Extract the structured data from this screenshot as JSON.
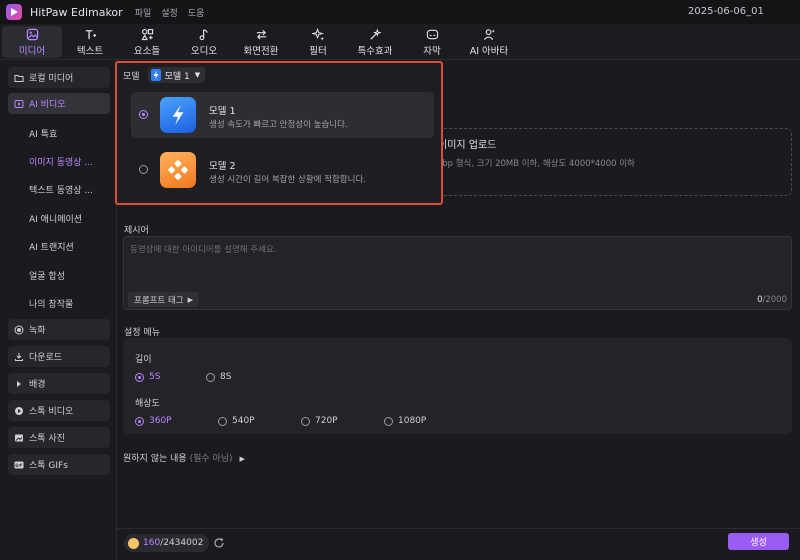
{
  "app": {
    "title": "HitPaw Edimakor",
    "menu": [
      "파일",
      "설정",
      "도움"
    ],
    "project_name": "2025-06-06_01"
  },
  "toolbar": {
    "items": [
      {
        "label": "미디어",
        "icon": "media-icon",
        "active": true
      },
      {
        "label": "텍스트",
        "icon": "text-icon"
      },
      {
        "label": "요소들",
        "icon": "elements-icon"
      },
      {
        "label": "오디오",
        "icon": "audio-icon"
      },
      {
        "label": "화면전환",
        "icon": "transition-icon"
      },
      {
        "label": "필터",
        "icon": "filter-icon"
      },
      {
        "label": "특수효과",
        "icon": "effects-icon"
      },
      {
        "label": "자막",
        "icon": "subtitle-icon"
      },
      {
        "label": "AI 아바타",
        "icon": "ai-avatar-icon"
      }
    ]
  },
  "sidebar": {
    "local_media": "로컬 미디어",
    "ai_video": "AI 비디오",
    "sub_items": [
      "AI 특효",
      "이미지 동영상 ...",
      "텍스트 동영상 ...",
      "AI 애니메이션",
      "AI 트랜지션",
      "얼굴 합성",
      "나의 창작물"
    ],
    "record": "녹화",
    "download": "다운로드",
    "background": "배경",
    "stock_video": "스톡 비디오",
    "stock_photo": "스톡 사진",
    "stock_gifs": "스톡 GIFs"
  },
  "upload": {
    "title": "이미지 업로드",
    "desc": "ebp 형식, 크기 20MB 이하, 해상도 4000*4000 이하"
  },
  "prompt": {
    "label": "제시어",
    "placeholder": "동영상에 대한 아이디어를 설명해 주세요.",
    "tag_button": "프롬프트 태그",
    "count_current": "0",
    "count_max": "/2000"
  },
  "settings": {
    "label": "설정 메뉴",
    "length_label": "길이",
    "length_options": [
      "5S",
      "8S"
    ],
    "length_selected": "5S",
    "resolution_label": "해상도",
    "resolution_options": [
      "360P",
      "540P",
      "720P",
      "1080P"
    ],
    "resolution_selected": "360P"
  },
  "negative": {
    "label": "원하지 않는 내용",
    "optional": "(필수 아님)"
  },
  "bottom": {
    "credits_current": "160",
    "credits_total": "/2434002",
    "generate": "생성"
  },
  "model_popup": {
    "label": "모델",
    "selected": "모델 1",
    "models": [
      {
        "name": "모델 1",
        "desc": "생성 속도가 빠르고 안정성이 높습니다.",
        "icon": "lightning-icon",
        "color": "#2f7df0"
      },
      {
        "name": "모델 2",
        "desc": "생성 시간이 길어 복잡한 상황에 적합합니다.",
        "icon": "diamond-grid-icon",
        "color": "#f58a2a"
      }
    ]
  },
  "colors": {
    "accent": "#b889ff",
    "highlight_border": "#e04b3a",
    "button": "#9b5cf6"
  }
}
